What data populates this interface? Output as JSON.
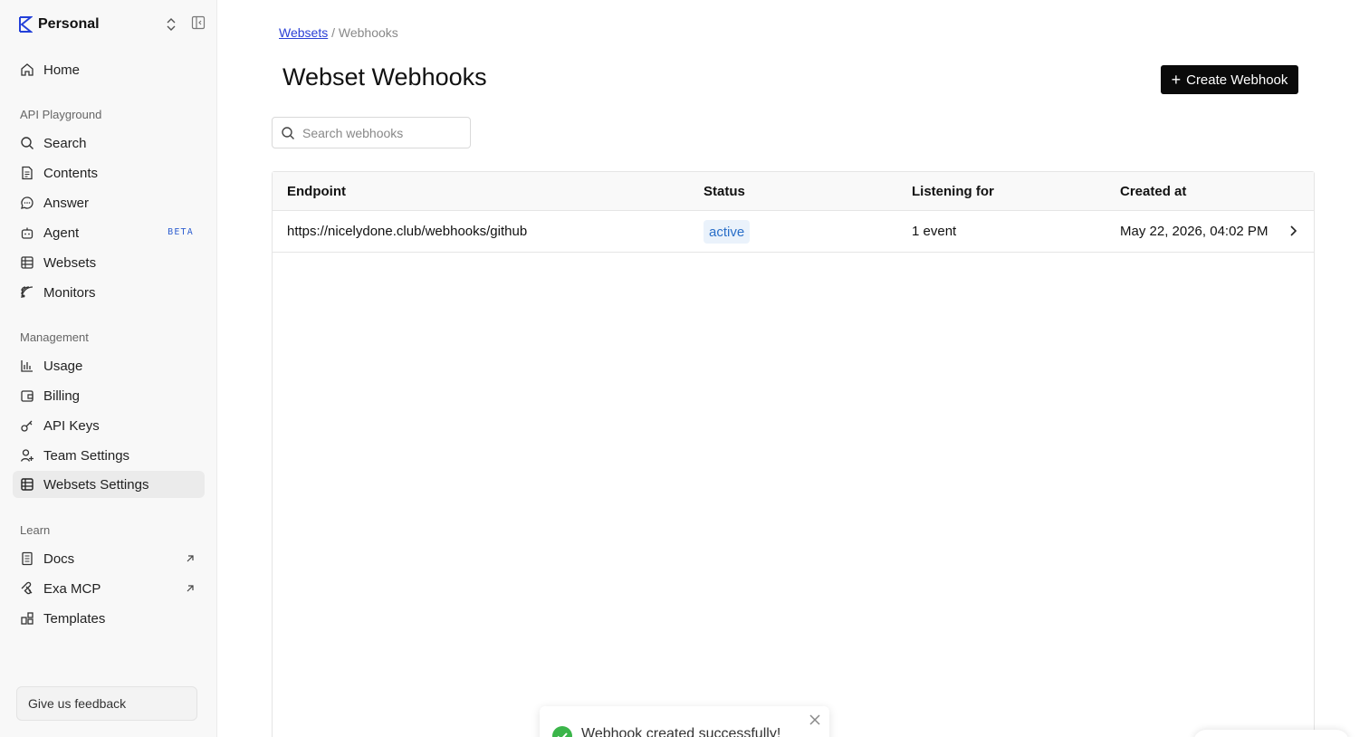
{
  "workspace": {
    "name": "Personal"
  },
  "nav": {
    "home": "Home",
    "api_playground_label": "API Playground",
    "api_playground": [
      {
        "label": "Search",
        "icon": "search-icon"
      },
      {
        "label": "Contents",
        "icon": "document-icon"
      },
      {
        "label": "Answer",
        "icon": "chat-bubble-icon"
      },
      {
        "label": "Agent",
        "icon": "robot-icon",
        "badge": "BETA"
      },
      {
        "label": "Websets",
        "icon": "grid-icon"
      },
      {
        "label": "Monitors",
        "icon": "radar-icon"
      }
    ],
    "management_label": "Management",
    "management": [
      {
        "label": "Usage",
        "icon": "bar-chart-icon"
      },
      {
        "label": "Billing",
        "icon": "wallet-icon"
      },
      {
        "label": "API Keys",
        "icon": "key-icon"
      },
      {
        "label": "Team Settings",
        "icon": "user-plus-icon"
      },
      {
        "label": "Websets Settings",
        "icon": "grid-icon"
      }
    ],
    "learn_label": "Learn",
    "learn": [
      {
        "label": "Docs",
        "icon": "book-icon"
      },
      {
        "label": "Exa MCP",
        "icon": "mcp-icon"
      },
      {
        "label": "Templates",
        "icon": "templates-icon"
      }
    ],
    "feedback": "Give us feedback"
  },
  "breadcrumb": {
    "link": "Websets",
    "separator": "/",
    "current": "Webhooks"
  },
  "page": {
    "title": "Webset Webhooks",
    "create_button": "Create Webhook",
    "search_placeholder": "Search webhooks"
  },
  "table": {
    "columns": [
      "Endpoint",
      "Status",
      "Listening for",
      "Created at"
    ],
    "rows": [
      {
        "endpoint": "https://nicelydone.club/webhooks/github",
        "status": "active",
        "listening_for": "1 event",
        "created_at": "May 22, 2026, 04:02 PM"
      }
    ]
  },
  "toast": {
    "message": "Webhook created successfully!"
  },
  "colors": {
    "accent_link": "#2a3fd6",
    "status_badge_bg": "#eaf2fb",
    "status_badge_text": "#2a6fc8",
    "success_green": "#3bb54a",
    "primary_button": "#0a0a0a"
  }
}
